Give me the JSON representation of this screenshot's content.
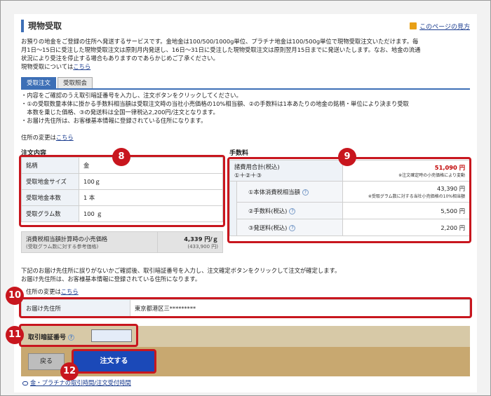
{
  "header": {
    "title": "現物受取",
    "help_link": "このページの見方"
  },
  "intro": {
    "line1": "お預りの地金をご登録の住所へ発送するサービスです。金地金は100/500/1000g単位、プラチナ地金は100/500g単位で現物受取注文いただけます。毎",
    "line2": "月1日～15日に受注した現物受取注文は原則月内発送し、16日～31日に受注した現物受取注文は原則翌月15日までに発送いたします。なお、地金の流通",
    "line3": "状況により受注を停止する場合もありますのであらかじめご了承ください。",
    "line4_prefix": "現物受取については",
    "line4_link": "こちら"
  },
  "tabs": [
    {
      "label": "受取注文",
      "active": true
    },
    {
      "label": "受取照会",
      "active": false
    }
  ],
  "notes": [
    "・内容をご確認のうえ取引暗証番号を入力し、注文ボタンをクリックしてください。",
    "・①の受取数量本体に掛かる手数料相当額は受取注文時の当社小売価格の10%相当額、②の手数料は1本あたりの地金の銘柄・単位により決まり受取",
    "　本数を乗じた価格、③の発送料は全国一律税込2,200円/注文となります。",
    "・お届け先住所は、お客様基本情報に登録されている住所になります。"
  ],
  "address_change": {
    "prefix": "住所の変更は",
    "link": "こちら"
  },
  "order": {
    "title": "注文内容",
    "rows": [
      {
        "label": "銘柄",
        "value": "金"
      },
      {
        "label": "受取地金サイズ",
        "value": "100ｇ"
      },
      {
        "label": "受取地金本数",
        "value": "1 本"
      },
      {
        "label": "受取グラム数",
        "value": "100 ｇ"
      }
    ],
    "retail_label": "消費税相当額計算時の小売価格",
    "retail_sub": "(受取グラム数に対する参考価格)",
    "retail_value": "4,339 円/ｇ",
    "retail_sub_value": "(433,900 円)"
  },
  "fees": {
    "title": "手数料",
    "total_label": "諸費用合計(税込)",
    "total_formula": "①＋②＋③",
    "total_value": "51,090 円",
    "total_note": "※注文確定時の小売価格により変動",
    "items": [
      {
        "label": "①本体消費税相当額",
        "value": "43,390 円",
        "note": "※受取グラム数に対する当社小売価格の10%相当額"
      },
      {
        "label": "②手数料(税込)",
        "value": "5,500 円",
        "note": ""
      },
      {
        "label": "③発送料(税込)",
        "value": "2,200 円",
        "note": ""
      }
    ]
  },
  "confirm": {
    "line1": "下記のお届け先住所に誤りがないかご確認後、取引暗証番号を入力し、注文確定ボタンをクリックして注文が確定します。",
    "line2": "お届け先住所は、お客様基本情報に登録されている住所になります。",
    "change_prefix": "住所の変更は",
    "change_link": "こちら"
  },
  "destination": {
    "label": "お届け先住所",
    "value": "東京都港区三*********"
  },
  "pin": {
    "label": "取引暗証番号",
    "value": ""
  },
  "buttons": {
    "back": "戻る",
    "order": "注文する"
  },
  "bottom_link": "金・プラチナの取引時間/注文受付時間",
  "badges": {
    "b8": "8",
    "b9": "9",
    "b10": "10",
    "b11": "11",
    "b12": "12"
  },
  "colors": {
    "accent": "#3d6fb6",
    "highlight": "#c8161e",
    "order_button": "#1b49b8"
  }
}
